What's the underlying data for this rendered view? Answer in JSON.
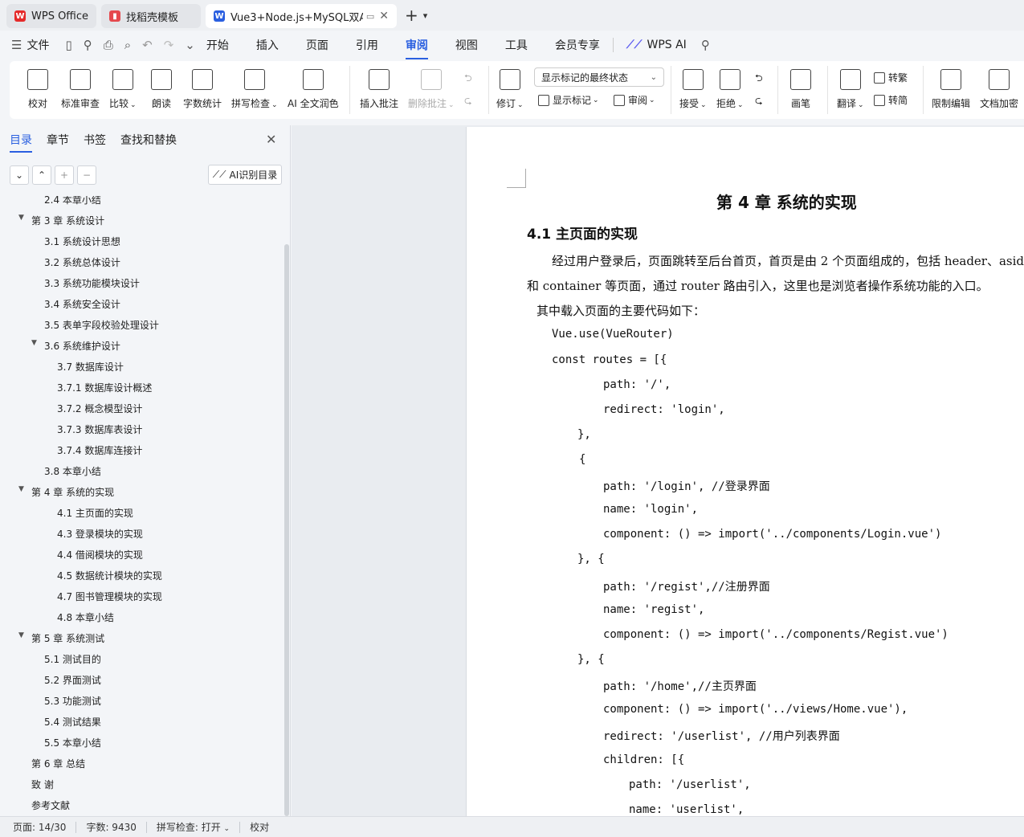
{
  "tabs": [
    {
      "label": "WPS Office"
    },
    {
      "label": "找稻壳模板"
    },
    {
      "label": "Vue3+Node.js+MySQL双A"
    }
  ],
  "menu": {
    "file": "文件",
    "items": [
      "开始",
      "插入",
      "页面",
      "引用",
      "审阅",
      "视图",
      "工具",
      "会员专享"
    ],
    "active": "审阅",
    "wps_ai": "WPS AI"
  },
  "ribbon": {
    "proofread": "校对",
    "standard_review": "标准审查",
    "compare": "比较",
    "read_aloud": "朗读",
    "word_count": "字数统计",
    "spell_check": "拼写检查",
    "ai_polish": "AI 全文润色",
    "insert_comment": "插入批注",
    "delete_comment": "删除批注",
    "track_changes": "修订",
    "markup_select": "显示标记的最终状态",
    "show_markup": "显示标记",
    "review_pane": "审阅",
    "accept": "接受",
    "reject": "拒绝",
    "pen": "画笔",
    "translate": "翻译",
    "to_traditional": "转繁",
    "to_simplified": "转简",
    "restrict_edit": "限制编辑",
    "encrypt": "文档加密"
  },
  "nav": {
    "tabs": [
      "目录",
      "章节",
      "书签",
      "查找和替换"
    ],
    "ai_toc": "AI识别目录",
    "toc": [
      {
        "text": "2.4 本章小结"
      },
      {
        "text": "第 3 章  系统设计"
      },
      {
        "text": "3.1 系统设计思想"
      },
      {
        "text": "3.2 系统总体设计"
      },
      {
        "text": "3.3 系统功能模块设计"
      },
      {
        "text": "3.4 系统安全设计"
      },
      {
        "text": "3.5 表单字段校验处理设计"
      },
      {
        "text": "3.6 系统维护设计"
      },
      {
        "text": "3.7 数据库设计"
      },
      {
        "text": "3.7.1 数据库设计概述"
      },
      {
        "text": "3.7.2 概念模型设计"
      },
      {
        "text": "3.7.3 数据库表设计"
      },
      {
        "text": "3.7.4 数据库连接计"
      },
      {
        "text": "3.8 本章小结"
      },
      {
        "text": "第 4 章  系统的实现"
      },
      {
        "text": "4.1 主页面的实现"
      },
      {
        "text": "4.3 登录模块的实现"
      },
      {
        "text": "4.4 借阅模块的实现"
      },
      {
        "text": "4.5 数据统计模块的实现"
      },
      {
        "text": "4.7 图书管理模块的实现"
      },
      {
        "text": "4.8 本章小结"
      },
      {
        "text": "第 5 章  系统测试"
      },
      {
        "text": "5.1 测试目的"
      },
      {
        "text": "5.2 界面测试"
      },
      {
        "text": "5.3 功能测试"
      },
      {
        "text": "5.4 测试结果"
      },
      {
        "text": "5.5 本章小结"
      },
      {
        "text": "第 6 章  总结"
      },
      {
        "text": "致  谢"
      },
      {
        "text": "参考文献"
      }
    ]
  },
  "document": {
    "chapter_title": "第 4 章  系统的实现",
    "section_title": "4.1 主页面的实现",
    "para1_line1": "经过用户登录后，页面跳转至后台首页，首页是由 2 个页面组成的，包括 header、aside",
    "para1_line2": "和 container 等页面，通过 router 路由引入，这里也是浏览者操作系统功能的入口。",
    "code_intro": "其中载入页面的主要代码如下：",
    "code_lines": [
      "Vue.use(VueRouter)",
      "const  routes  =  [{",
      "path:  '/',",
      "redirect:  'login',",
      "},",
      "{",
      "path:  '/login', //登录界面",
      "name:  'login',",
      "component:  ()  =>  import('../components/Login.vue')",
      "},  {",
      "path:  '/regist',//注册界面",
      "name:  'regist',",
      "component:  ()  =>  import('../components/Regist.vue')",
      "},  {",
      "path:  '/home',//主页界面",
      "component:  ()  =>  import('../views/Home.vue'),",
      "redirect:  '/userlist', //用户列表界面",
      "children:  [{",
      "path:  '/userlist',",
      "name:  'userlist',"
    ]
  },
  "status": {
    "page": "页面: 14/30",
    "words": "字数: 9430",
    "spell": "拼写检查: 打开",
    "proof": "校对"
  },
  "colors": {
    "accent": "#2a5fe0",
    "wps_red": "#e52a2a"
  }
}
